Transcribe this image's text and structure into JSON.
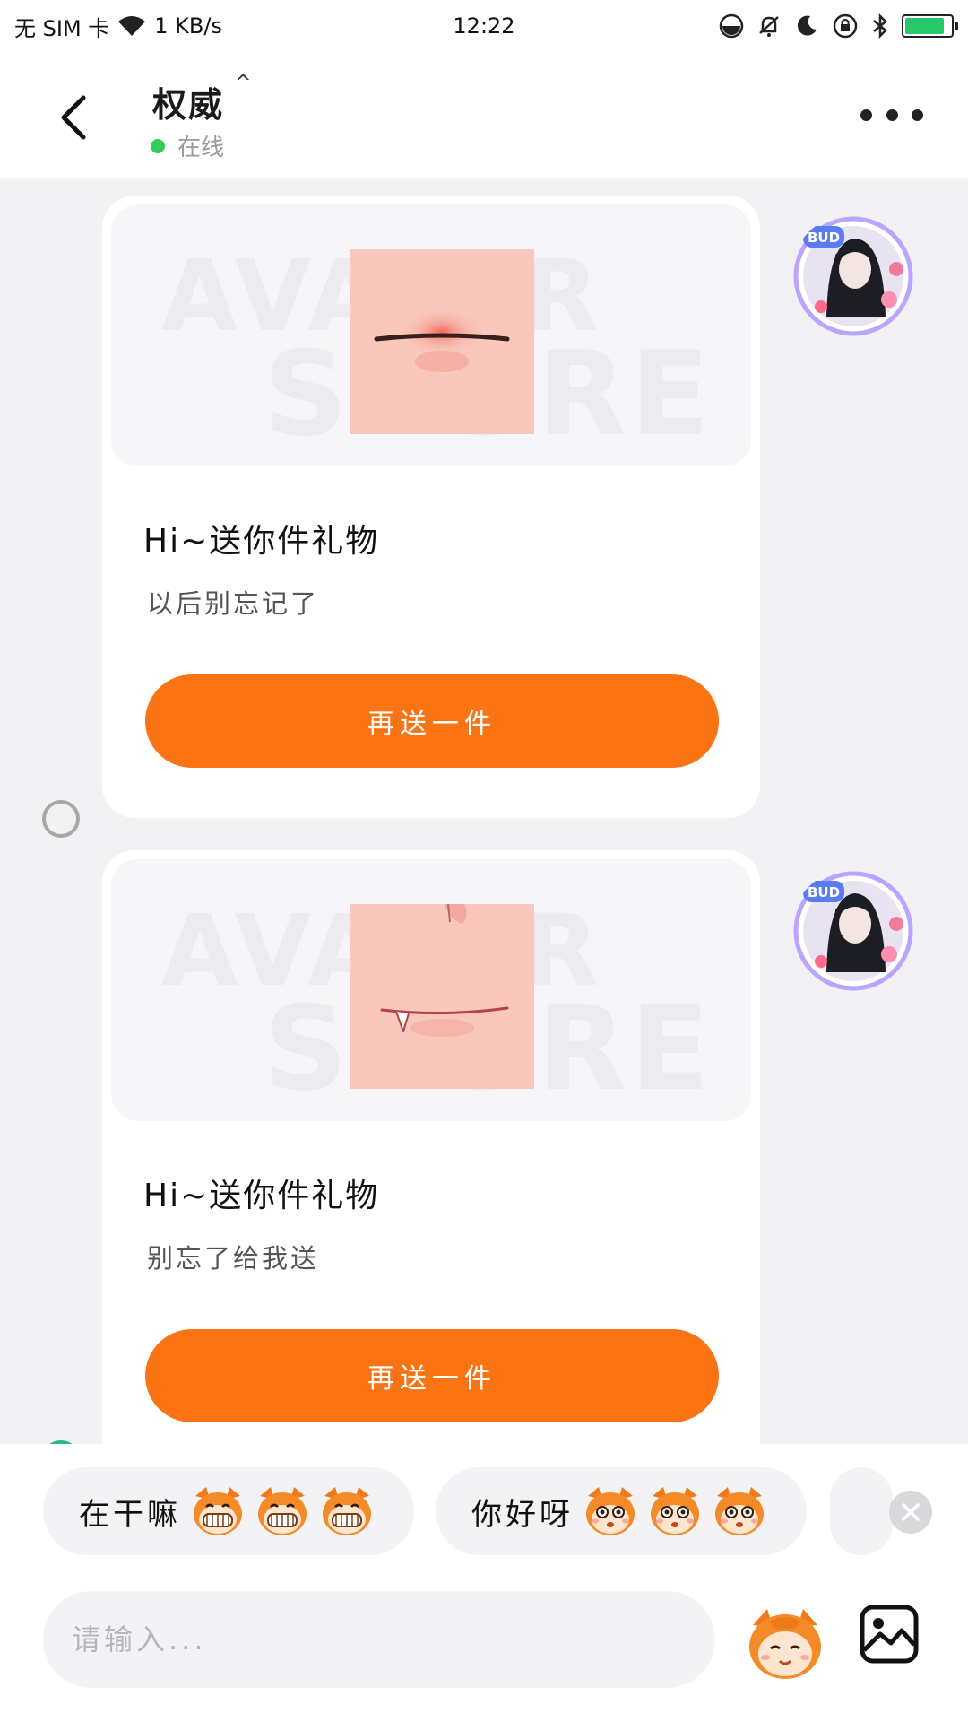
{
  "status_bar": {
    "carrier": "无 SIM 卡",
    "speed": "1 KB/s",
    "time": "12:22",
    "icons": [
      "wifi-icon",
      "dnd-icon",
      "mute-bell-icon",
      "moon-icon",
      "rotation-lock-icon",
      "bluetooth-icon",
      "battery-charging-icon"
    ],
    "battery_level": 0.85
  },
  "header": {
    "name": "权威",
    "name_suffix": "^",
    "online_status": "在线",
    "online_color": "#2ed158"
  },
  "messages": [
    {
      "card_title": "Hi~送你件礼物",
      "card_subtitle": "以后别忘记了",
      "button_label": "再送一件",
      "watermark_line1": "AVATAR",
      "watermark_line2": "STORE",
      "avatar_badge": "BUD",
      "gift": "mouth-closed-smile"
    },
    {
      "card_title": "Hi~送你件礼物",
      "card_subtitle": "别忘了给我送",
      "button_label": "再送一件",
      "watermark_line1": "AVATAR",
      "watermark_line2": "STORE",
      "avatar_badge": "BUD",
      "gift": "mouth-fang"
    }
  ],
  "quick_replies": [
    {
      "text": "在干嘛",
      "emoji": "grinning-mascot-emoji"
    },
    {
      "text": "你好呀",
      "emoji": "surprised-mascot-emoji"
    }
  ],
  "input": {
    "placeholder": "请输入..."
  },
  "colors": {
    "accent": "#fb7413",
    "background": "#f2f2f4"
  }
}
